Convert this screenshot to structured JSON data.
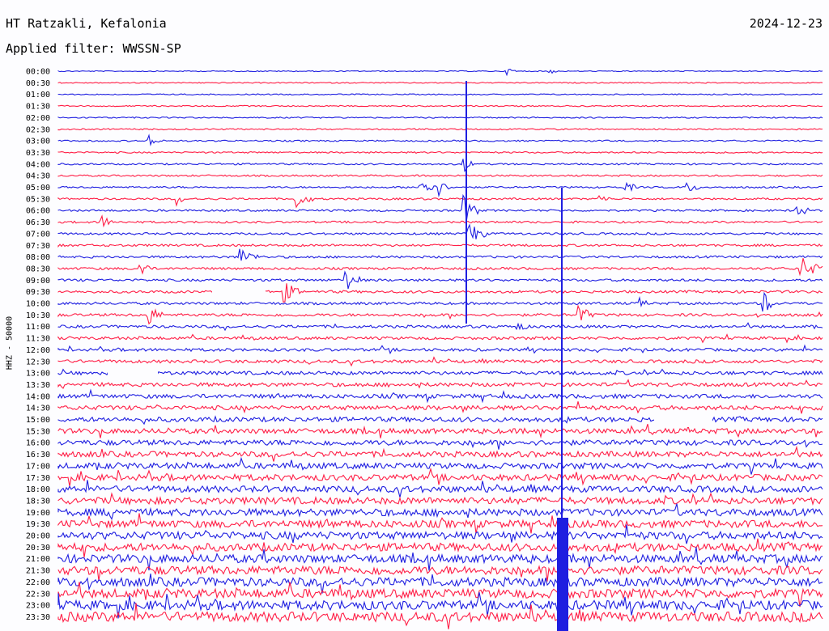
{
  "header": {
    "station": "HT Ratzakli, Kefalonia",
    "date": "2024-12-23",
    "filter": "Applied filter: WWSSN-SP"
  },
  "axis": {
    "channel_label": "HHZ - 50000"
  },
  "colors": {
    "blue": "#1e1ee0",
    "red": "#ff1e46",
    "background": "#fdfdff"
  },
  "rows": [
    "00:00",
    "00:30",
    "01:00",
    "01:30",
    "02:00",
    "02:30",
    "03:00",
    "03:30",
    "04:00",
    "04:30",
    "05:00",
    "05:30",
    "06:00",
    "06:30",
    "07:00",
    "07:30",
    "08:00",
    "08:30",
    "09:00",
    "09:30",
    "10:00",
    "10:30",
    "11:00",
    "11:30",
    "12:00",
    "12:30",
    "13:00",
    "13:30",
    "14:00",
    "14:30",
    "15:00",
    "15:30",
    "16:00",
    "16:30",
    "17:00",
    "17:30",
    "18:00",
    "18:30",
    "19:00",
    "19:30",
    "20:00",
    "20:30",
    "21:00",
    "21:30",
    "22:00",
    "22:30",
    "23:00",
    "23:30"
  ]
}
